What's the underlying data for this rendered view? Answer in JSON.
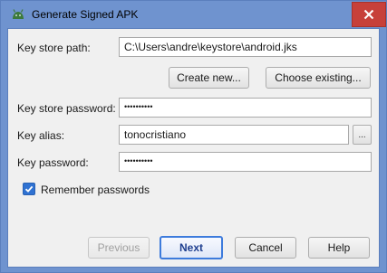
{
  "window": {
    "title": "Generate Signed APK"
  },
  "form": {
    "key_store_path_label": "Key store path:",
    "key_store_path_value": "C:\\Users\\andre\\keystore\\android.jks",
    "create_new_label": "Create new...",
    "choose_existing_label": "Choose existing...",
    "key_store_password_label": "Key store password:",
    "key_store_password_value": "••••••••••",
    "key_alias_label": "Key alias:",
    "key_alias_value": "tonocristiano",
    "browse_label": "...",
    "key_password_label": "Key password:",
    "key_password_value": "••••••••••",
    "remember_label": "Remember passwords",
    "remember_checked": true
  },
  "buttons": {
    "previous": "Previous",
    "next": "Next",
    "cancel": "Cancel",
    "help": "Help"
  },
  "icons": {
    "app": "android-icon",
    "close": "close-icon",
    "check": "checkmark-icon"
  },
  "colors": {
    "title_bar": "#6f93cf",
    "close_button": "#c7403a",
    "checkbox": "#2f72d2",
    "primary_border": "#3d7bdc"
  }
}
